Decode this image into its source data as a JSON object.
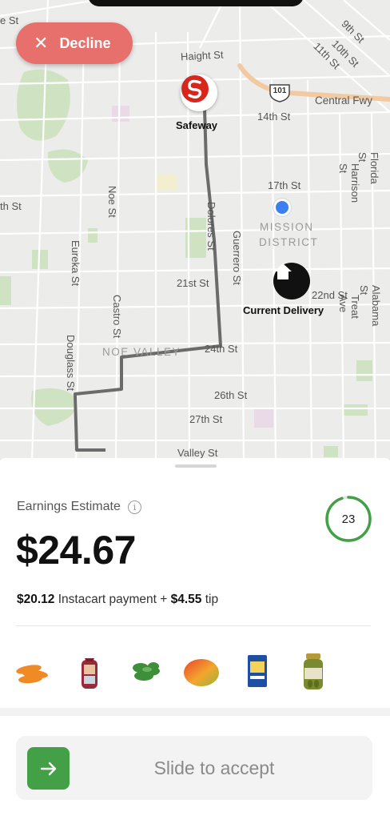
{
  "header": {
    "decline_label": "Decline",
    "decline_icon": "close-icon"
  },
  "map": {
    "streets": [
      "Haight St",
      "14th St",
      "17th St",
      "21st St",
      "22nd St",
      "24th St",
      "26th St",
      "27th St",
      "Valley St",
      "Noe St",
      "Dolores St",
      "Guerrero St",
      "Eureka St",
      "Castro St",
      "Douglass St",
      "Harrison St",
      "Florida St",
      "Alabama St",
      "Treat Ave",
      "Central Fwy",
      "9th St",
      "10th St",
      "11th St",
      "th St",
      "e St"
    ],
    "highway_shield": "101",
    "districts": [
      "MISSION",
      "DISTRICT",
      "NOE VALLEY"
    ],
    "store_label": "Safeway",
    "delivery_label": "Current Delivery",
    "route_color": "#6b6b6b",
    "user_dot_color": "#3d7ff2",
    "store_color": "#d9261c"
  },
  "sheet": {
    "earnings_label": "Earnings Estimate",
    "amount": "$24.67",
    "payment_amount": "$20.12",
    "payment_text": " Instacart payment + ",
    "tip_amount": "$4.55",
    "tip_text": " tip",
    "timer_value": "23",
    "timer_fraction": 0.95,
    "timer_color": "#43a047",
    "items": [
      "carrots-icon",
      "bread-icon",
      "greens-icon",
      "mango-icon",
      "pasta-box-icon",
      "pickle-jar-icon"
    ],
    "slide_label": "Slide to accept",
    "accent": "#43a047"
  }
}
